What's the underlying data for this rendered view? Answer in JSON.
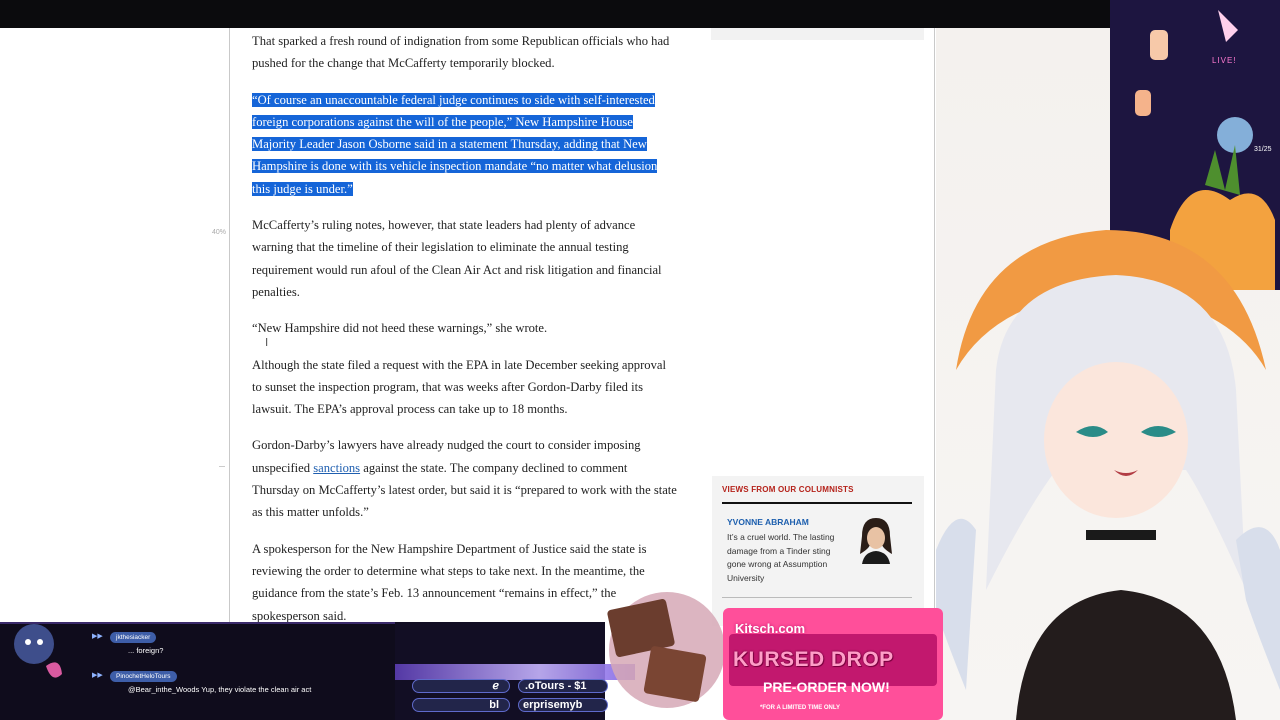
{
  "article": {
    "paragraphs": [
      {
        "text": "That sparked a fresh round of indignation from some Republican officials who had pushed for the change that McCafferty temporarily blocked."
      },
      {
        "text": "“Of course an unaccountable federal judge continues to side with self-interested foreign corporations against the will of the people,” New Hampshire House Majority Leader Jason Osborne said in a statement Thursday, adding that New Hampshire is done with its vehicle inspection mandate “no matter what delusion this judge is under.”"
      },
      {
        "text": "McCafferty’s ruling notes, however, that state leaders had plenty of advance warning that the timeline of their legislation to eliminate the annual testing requirement would run afoul of the Clean Air Act and risk litigation and financial penalties."
      },
      {
        "text": "“New Hampshire did not heed these warnings,” she wrote."
      },
      {
        "text": "Although the state filed a request with the EPA in late December seeking approval to sunset the inspection program, that was weeks after Gordon-Darby filed its lawsuit. The EPA’s approval process can take up to 18 months."
      },
      {
        "before": "Gordon-Darby’s lawyers have already nudged the court to consider imposing unspecified ",
        "link": "sanctions",
        "after": " against the state. The company declined to comment Thursday on McCafferty’s latest order, but said it is “prepared to work with the state as this matter unfolds.”"
      },
      {
        "text": "A spokesperson for the New Hampshire Department of Justice said the state is reviewing the order to determine what steps to take next. In the meantime, the guidance from the state’s Feb. 13 announcement “remains in effect,” the spokesperson said."
      }
    ],
    "margin_mark": "40%"
  },
  "columnists": {
    "heading": "VIEWS FROM OUR COLUMNISTS",
    "name": "YVONNE ABRAHAM",
    "blurb": "It’s a cruel world. The lasting damage from a Tinder sting gone wrong at Assumption University"
  },
  "stream": {
    "live_label": "LIVE!",
    "counter": "31/25",
    "chat": [
      {
        "user": "jkthesiacker",
        "message": "... foreign?"
      },
      {
        "user": "PinochetHeloTours",
        "message": "@Bear_inthe_Woods Yup, they violate the clean air act"
      }
    ],
    "ticker": [
      "ℯ",
      ".oTours - $1",
      "bl",
      "erprisemyb"
    ],
    "promo": {
      "brand": "Kitsch.com",
      "title": "KURSED DROP",
      "subtitle": "PRE-ORDER NOW!",
      "note": "*FOR A LIMITED TIME ONLY"
    }
  },
  "colors": {
    "highlight": "#1565d8",
    "link": "#1f5fb0",
    "columnist_heading": "#b5221a",
    "columnist_name": "#1d5fae"
  }
}
